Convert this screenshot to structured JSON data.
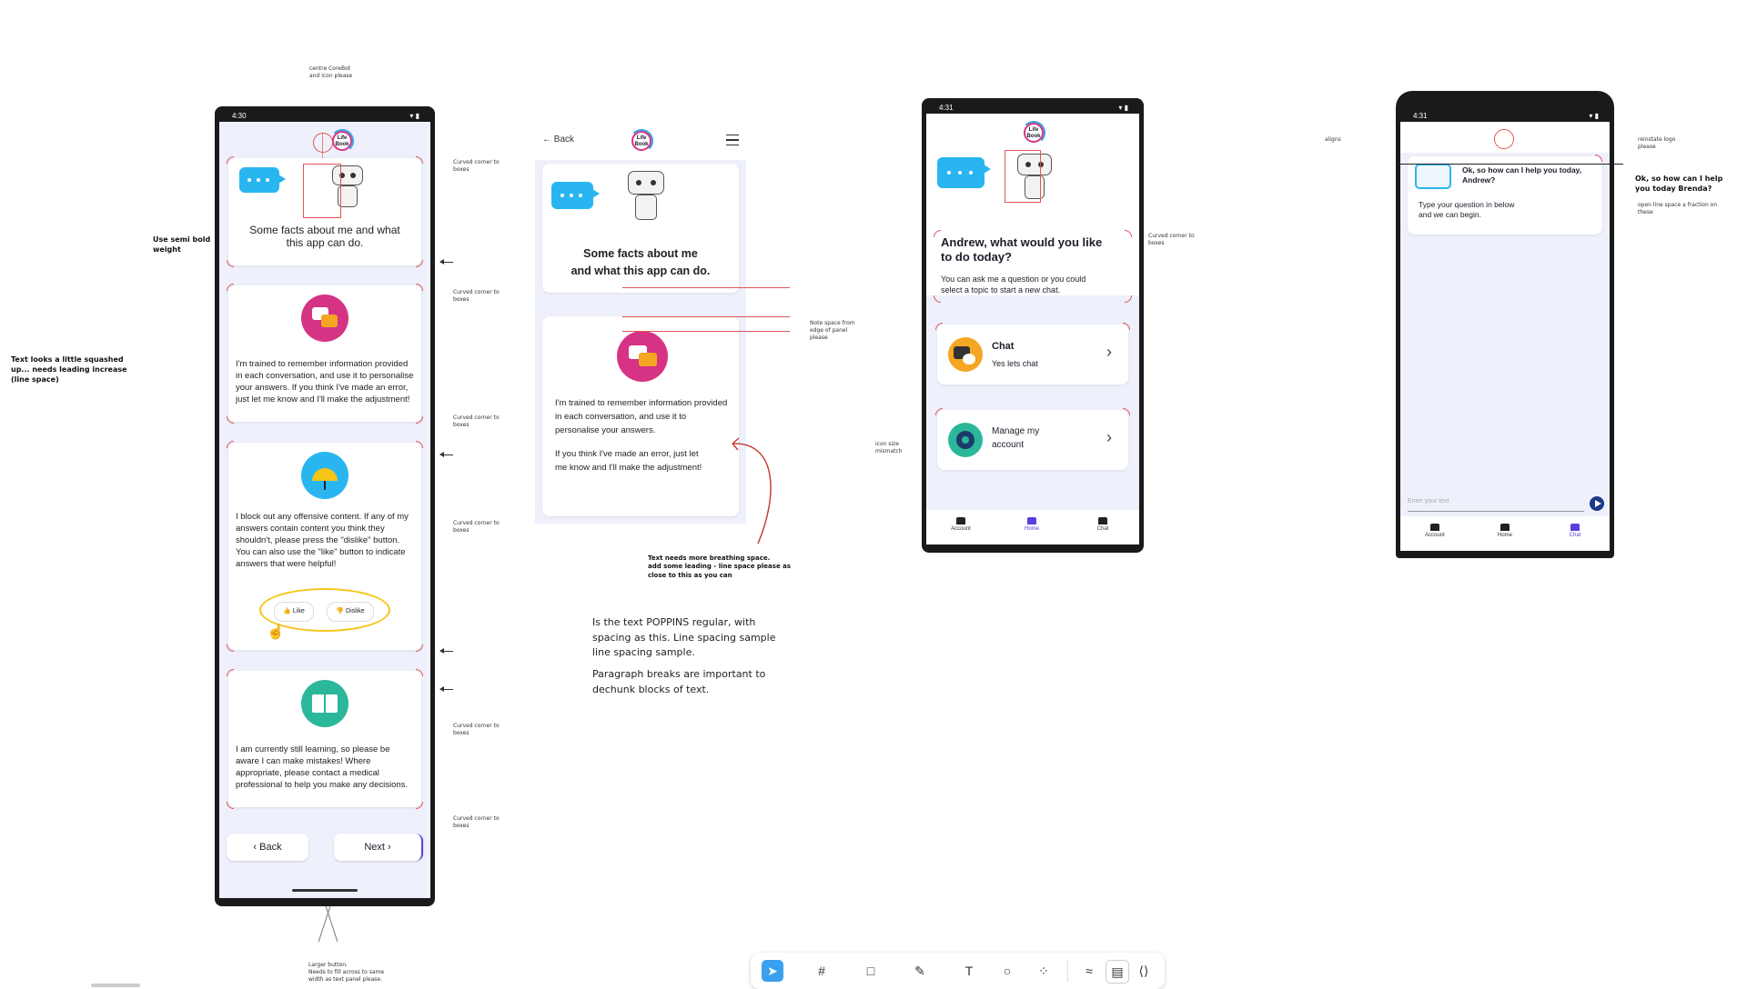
{
  "notes": {
    "centre_logo": "centre CoreBot\nand icon please",
    "semi_bold": "Use semi bold\nweight",
    "squashed": "Text looks a  little squashed\nup... needs leading increase\n(line space)",
    "curved_corner": "Curved corner to\nboxes",
    "note_space": "Note space from\nedge of panel\nplease",
    "breathing": "Text needs more breathing space.\nadd some leading - line space please as\nclose to this as you can",
    "icon_size": "icon size\nmismatch",
    "aligns": "aligns",
    "reinstate_logo": "reinstate logo\nplease",
    "open_line_space": "open line space a fraction on\nthese",
    "larger_button": "Larger button.\nNeeds to fill across to same\nwidth as text panel please.",
    "poppins_1": "Is the text POPPINS regular, with\nspacing as this. Line spacing sample\nline spacing sample.",
    "poppins_2": "Paragraph breaks are important to\ndechunk blocks of text.",
    "brenda": "Ok, so how can I help\nyou today Brenda?"
  },
  "phone1": {
    "time": "4:30",
    "logo": "Life\nBook",
    "card1_title": "Some facts about me and what\nthis app can do.",
    "card2_text": "I'm trained to remember information provided in each conversation, and use it to personalise your answers. If you think I've made an error, just let me know and I'll make the adjustment!",
    "card3_text": "I block out any offensive content. If any of my answers contain content you think they shouldn't, please press the \"dislike\" button. You can also use the \"like\" button to indicate answers that were helpful!",
    "like": "Like",
    "dislike": "Dislike",
    "card4_text": "I am currently still learning, so please be aware I can make mistakes! Where appropriate, please contact a medical professional to help you make any decisions.",
    "back": "‹ Back",
    "next": "Next ›"
  },
  "panel2": {
    "back": "← Back",
    "logo": "Life\nBook",
    "card1_title": "Some facts about me\nand what this app can do.",
    "card2_p1": "I'm trained to remember information provided in each conversation, and use it to personalise your answers.",
    "card2_p2": "If you think I've made an error, just let me know and I'll make the adjustment!"
  },
  "phone3": {
    "time": "4:31",
    "logo": "Life\nBook",
    "heading": "Andrew, what would you like\nto do today?",
    "sub": "You can ask me a question or you could\nselect a topic to start a new chat.",
    "chat_title": "Chat",
    "chat_sub": "Yes lets chat",
    "manage": "Manage my\naccount",
    "nav_account": "Account",
    "nav_home": "Home",
    "nav_chat": "Chat"
  },
  "phone4": {
    "time": "4:31",
    "greeting": "Ok, so how can I help you today,\nAndrew?",
    "prompt": "Type your question in below\nand we can begin.",
    "input_placeholder": "Enter your text",
    "nav_account": "Account",
    "nav_home": "Home",
    "nav_chat": "Chat"
  },
  "colors": {
    "accent": "#5a3fe0",
    "bubble": "#29b6f0",
    "magenta": "#d63384",
    "annotation_red": "#e05555",
    "annotation_yellow": "#f5c518"
  }
}
